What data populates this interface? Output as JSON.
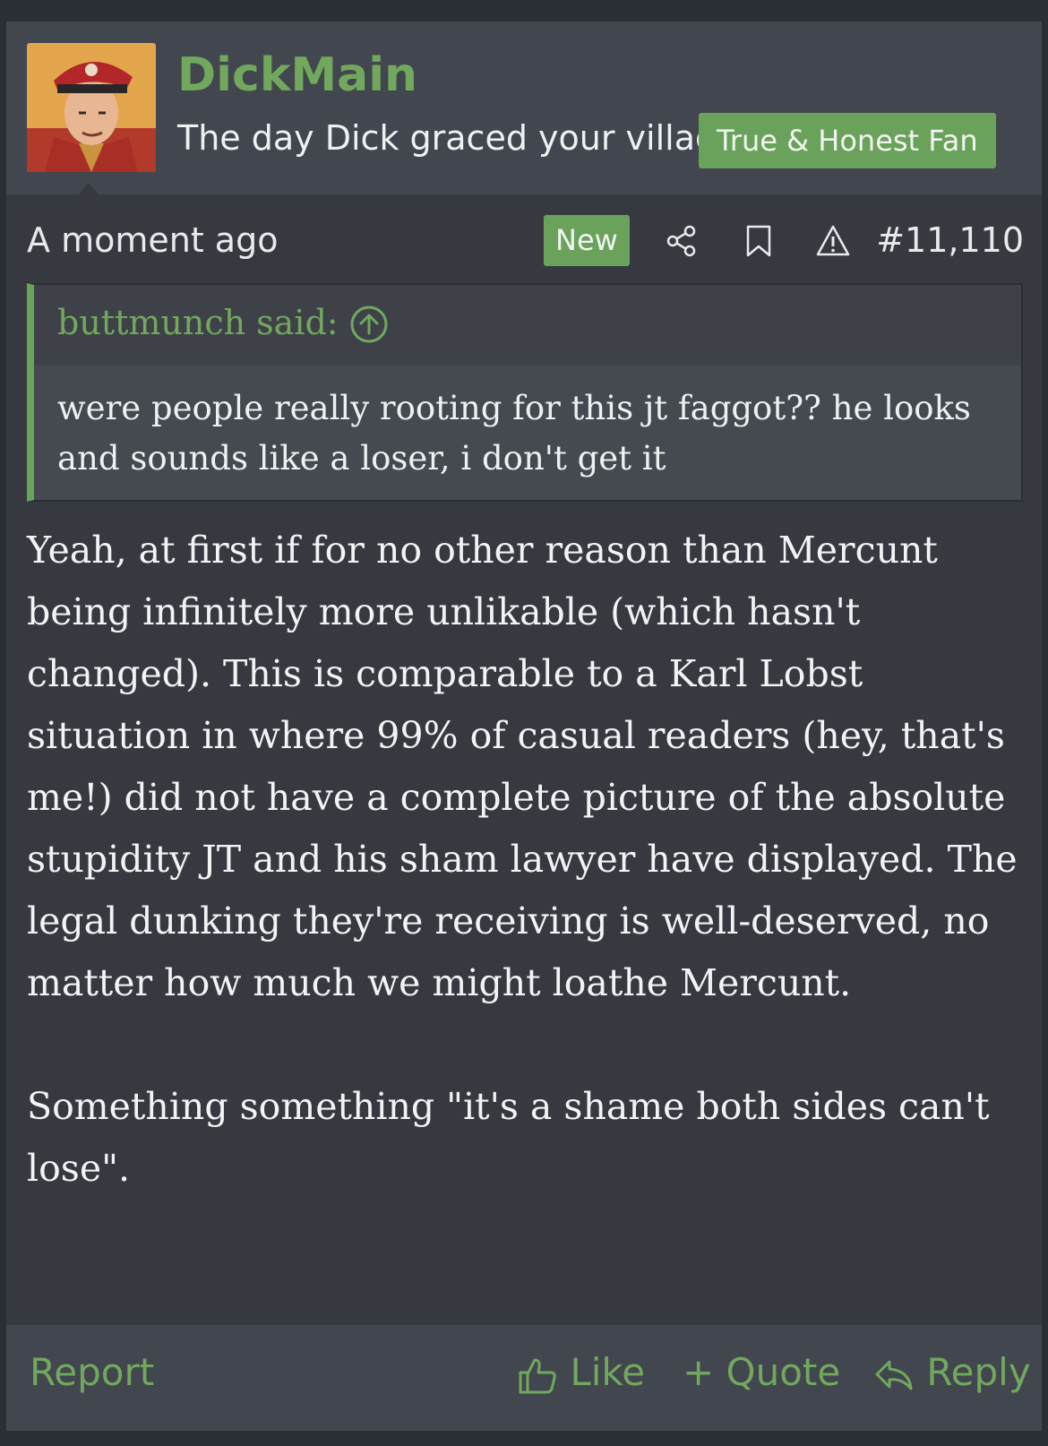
{
  "user": {
    "name": "DickMain",
    "title": "The day Dick graced your village",
    "banner": "True & Honest Fan",
    "avatar_icon": "avatar-officer-portrait"
  },
  "meta": {
    "time": "A moment ago",
    "new_badge": "New",
    "post_number": "#11,110",
    "icons": [
      "share-icon",
      "bookmark-icon",
      "report-warning-icon"
    ]
  },
  "quote": {
    "author": "buttmunch said:",
    "text": "were people really rooting for this jt faggot?? he looks and sounds like a loser, i don't get it"
  },
  "message": {
    "paragraphs": [
      "Yeah, at first if for no other reason than Mercunt being infinitely more unlikable (which hasn't changed). This is comparable to a Karl Lobst situation in where 99% of casual readers (hey, that's me!) did not have a complete picture of the absolute stupidity JT and his sham lawyer have displayed. The legal dunking they're receiving is well-deserved, no matter how much we might loathe Mercunt.",
      "Something something \"it's a shame both sides can't lose\"."
    ]
  },
  "footer": {
    "report": "Report",
    "like": "Like",
    "quote": "+ Quote",
    "reply": "Reply"
  },
  "colors": {
    "accent": "#6aa25b",
    "link": "#72a85e",
    "panel": "#363a40",
    "panel_light": "#42464e"
  }
}
